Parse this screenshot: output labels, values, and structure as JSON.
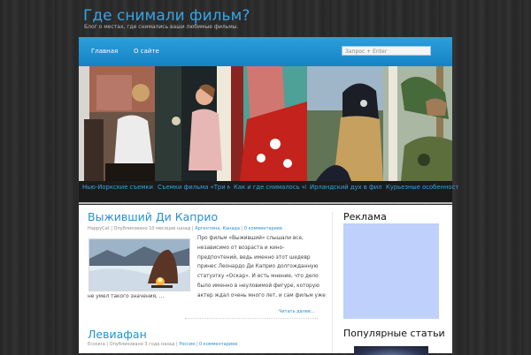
{
  "site": {
    "title": "Где снимали фильм?",
    "description": "Блог о местах, где снимались ваши любимые фильмы."
  },
  "nav": {
    "items": [
      "Главная",
      "О сайте"
    ],
    "search_placeholder": "Запрос + Enter"
  },
  "slider": {
    "captions": [
      "Нью-Йоркские съемки «В большом городе»",
      "Съемки фильма «Три метра над небом»",
      "Как и где снималось «Безумие в пустыне»",
      "Ирландский дух в фильме «Я люблю»",
      "Курьезные особенности охоты"
    ]
  },
  "posts": [
    {
      "title": "Выживший Ди Каприо",
      "meta_author": "HappyCat",
      "meta_sep1": "|",
      "meta_published": "Опубликовано 10 месяцев назад",
      "meta_sep2": "|",
      "meta_cat1": "Аргентина",
      "meta_comma": ",",
      "meta_cat2": "Канада",
      "meta_sep3": "|",
      "meta_comments": "0 комментариев",
      "text_lines": [
        "Про фильм «Выживший» слышали все,",
        "независимо от возраста и кино-",
        "предпочтений, ведь именно этот шедевр",
        "принес Леонардо Ди Каприо долгожданную",
        "статуэтку «Оскар». И есть мнение, что дело",
        "было именно в неуловимой фигуре, которую",
        "актер ждал очень много лет, и сам фильм уже"
      ],
      "text_tail": "не умел такого значения, ...",
      "read_more": "Читать далее..."
    },
    {
      "title": "Левиафан",
      "meta_author": "Ecosera",
      "meta_sep1": "|",
      "meta_published": "Опубликовано 3 года назад",
      "meta_sep2": "|",
      "meta_cat1": "Россия",
      "meta_sep3": "|",
      "meta_comments": "0 комментариев"
    }
  ],
  "sidebar": {
    "ad_title": "Реклама",
    "popular_title": "Популярные статьи"
  },
  "colors": {
    "accent": "#2790d0",
    "nav_bar": "#1e8fd0",
    "ad_box": "#bed0fb"
  }
}
